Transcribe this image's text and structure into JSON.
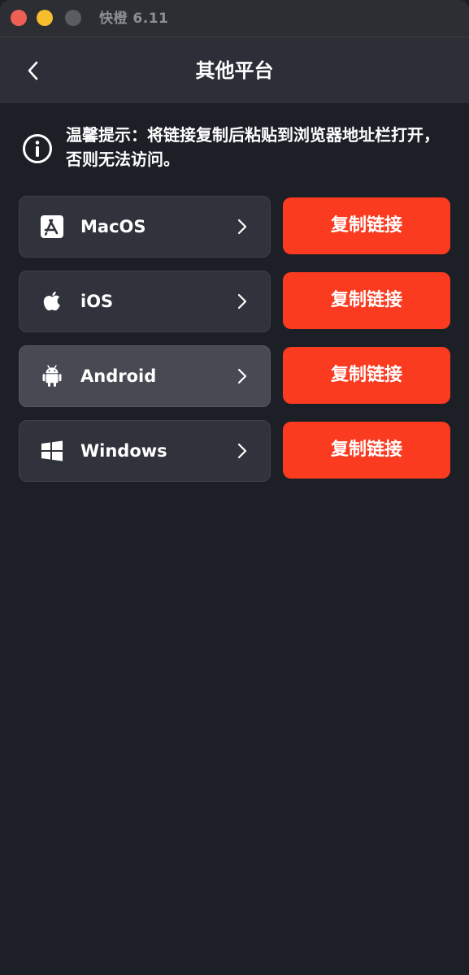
{
  "window": {
    "title": "快橙 6.11"
  },
  "navbar": {
    "title": "其他平台"
  },
  "notice": {
    "text": "温馨提示：将链接复制后粘贴到浏览器地址栏打开，否则无法访问。",
    "icon": "info-circle-icon"
  },
  "platforms": [
    {
      "name": "MacOS",
      "icon": "app-store-icon",
      "copy_label": "复制链接"
    },
    {
      "name": "iOS",
      "icon": "apple-icon",
      "copy_label": "复制链接"
    },
    {
      "name": "Android",
      "icon": "android-icon",
      "copy_label": "复制链接"
    },
    {
      "name": "Windows",
      "icon": "windows-icon",
      "copy_label": "复制链接"
    }
  ],
  "colors": {
    "accent": "#fa3b20",
    "background": "#1d1f27",
    "card": "#31333c",
    "card_selected": "#474a53"
  }
}
